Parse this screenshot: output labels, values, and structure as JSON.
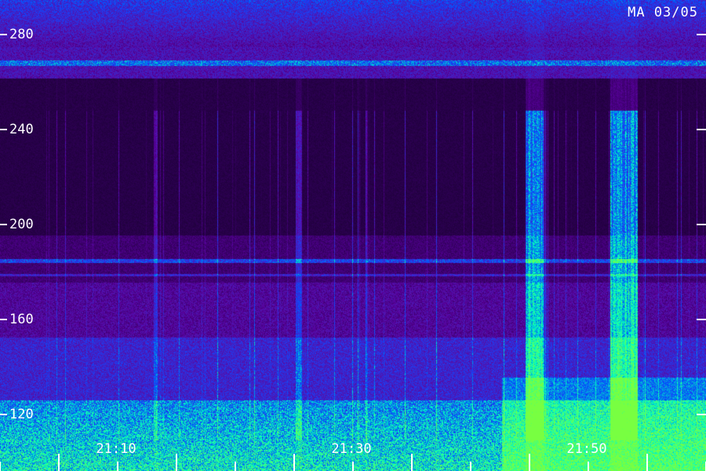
{
  "title": "MA 03/05",
  "colors": {
    "background": "#000000",
    "low": "#5a00a8",
    "mid": "#1a4aff",
    "high": "#00ffaa",
    "peak": "#80ff40",
    "text": "#ffffff"
  },
  "y_axis": {
    "ticks": [
      {
        "label": "280",
        "value": 280
      },
      {
        "label": "240",
        "value": 240
      },
      {
        "label": "200",
        "value": 200
      },
      {
        "label": "160",
        "value": 160
      },
      {
        "label": "120",
        "value": 120
      }
    ]
  },
  "x_axis": {
    "ticks": [
      {
        "label": "21:10"
      },
      {
        "label": "21:30"
      },
      {
        "label": "21:50"
      }
    ]
  }
}
